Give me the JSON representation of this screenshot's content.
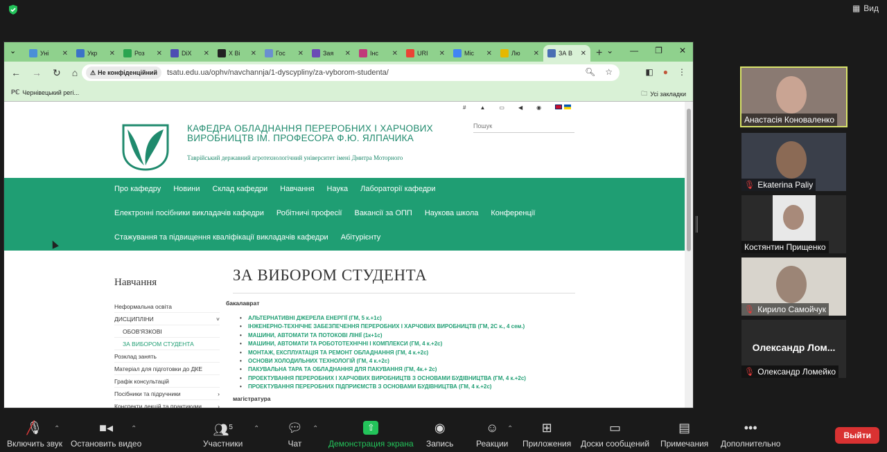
{
  "zoom": {
    "view_label": "Вид",
    "bottom": {
      "mute": "Включить звук",
      "video": "Остановить видео",
      "participants": "Участники",
      "participants_count": "5",
      "chat": "Чат",
      "share": "Демонстрация экрана",
      "record": "Запись",
      "reactions": "Реакции",
      "apps": "Приложения",
      "whiteboards": "Доски сообщений",
      "notes": "Примечания",
      "more": "Дополнительно",
      "leave": "Выйти"
    },
    "participants": [
      {
        "name": "Анастасія Коноваленко",
        "muted": false,
        "speaking": true
      },
      {
        "name": "Ekaterina Paliy",
        "muted": true
      },
      {
        "name": "Костянтин Прищенко",
        "muted": false
      },
      {
        "name": "Кирило Самойчук",
        "muted": true
      },
      {
        "name": "Олександр Ломейко",
        "display": "Олександр  Лом...",
        "muted": true
      }
    ]
  },
  "browser": {
    "tabs": [
      {
        "label": "Уні",
        "color": "#4a8fd8"
      },
      {
        "label": "Укр",
        "color": "#3b73c7"
      },
      {
        "label": "Роз",
        "color": "#2aa44f"
      },
      {
        "label": "DiX",
        "color": "#4d4db3"
      },
      {
        "label": "X Ві",
        "color": "#222222"
      },
      {
        "label": "Гос",
        "color": "#6a8fd0"
      },
      {
        "label": "Зая",
        "color": "#6b4bb5"
      },
      {
        "label": "Інс",
        "color": "#c03a7a"
      },
      {
        "label": "URI",
        "color": "#ea4335"
      },
      {
        "label": "Міс",
        "color": "#4285f4"
      },
      {
        "label": "Лю",
        "color": "#e6b800"
      },
      {
        "label": "ЗА В",
        "color": "#4a6fb3",
        "active": true
      }
    ],
    "insecure_label": "Не конфіденційний",
    "url": "tsatu.edu.ua/ophv/navchannja/1-dyscypliny/za-vyborom-studenta/",
    "bookmark": "Чернівецький регі...",
    "all_bookmarks": "Усі закладки"
  },
  "site": {
    "title": "КАФЕДРА ОБЛАДНАННЯ ПЕРЕРОБНИХ І ХАРЧОВИХ ВИРОБНИЦТВ ІМ. ПРОФЕСОРА Ф.Ю. ЯЛПАЧИКА",
    "subtitle": "Таврійський державний агротехнологічний університет імені Дмитра Моторного",
    "search_placeholder": "Пошук",
    "menu_row1": [
      "Про кафедру",
      "Новини",
      "Склад кафедри",
      "Навчання",
      "Наука",
      "Лабораторії кафедри"
    ],
    "menu_row2": [
      "Електронні посібники викладачів кафедри",
      "Робітничі професії",
      "Вакансії за ОПП",
      "Наукова школа",
      "Конференції"
    ],
    "menu_row3": [
      "Стажування та підвищення кваліфікації викладачів кафедри",
      "Абітурієнту"
    ],
    "sidebar_title": "Навчання",
    "sidebar": [
      {
        "label": "Неформальна освіта"
      },
      {
        "label": "ДИСЦИПЛІНИ",
        "chev": "˅"
      },
      {
        "label": "ОБОВ'ЯЗКОВІ",
        "sub": true
      },
      {
        "label": "ЗА ВИБОРОМ СТУДЕНТА",
        "sub": true,
        "active": true
      },
      {
        "label": "Розклад занять"
      },
      {
        "label": "Матеріал для підготовки до ДКЕ"
      },
      {
        "label": "Графік консультацій"
      },
      {
        "label": "Посібники та підручники",
        "chev": "›"
      },
      {
        "label": "Конспекти лекцій та практикуми",
        "chev": "›"
      }
    ],
    "page_title": "ЗА ВИБОРОМ СТУДЕНТА",
    "bachelor_label": "бакалаврат",
    "bachelor_list": [
      "АЛЬТЕРНАТИВНІ ДЖЕРЕЛА ЕНЕРГІЇ (ГМ, 5 к.+1с)",
      "ІНЖЕНЕРНО-ТЕХНІЧНЕ ЗАБЕЗПЕЧЕННЯ ПЕРЕРОБНИХ І ХАРЧОВИХ ВИРОБНИЦТВ (ГМ, 2С к., 4 сем.)",
      "МАШИНИ, АВТОМАТИ ТА ПОТОКОВІ ЛІНІЇ (1к+1с)",
      "МАШИНИ, АВТОМАТИ  ТА РОБОТОТЕХНІЧНІ І КОМПЛЕКСИ (ГМ, 4 к.+2с)",
      "МОНТАЖ, ЕКСПЛУАТАЦІЯ ТА РЕМОНТ ОБЛАДНАННЯ (ГМ, 4 к.+2с)",
      "ОСНОВИ ХОЛОДИЛЬНИХ ТЕХНОЛОГІЙ (ГМ, 4 к.+2с)",
      "ПАКУВАЛЬНА ТАРА ТА ОБЛАДНАННЯ ДЛЯ ПАКУВАННЯ (ГМ, 4к.+ 2с)",
      "ПРОЕКТУВАННЯ ПЕРЕРОБНИХ І ХАРЧОВИХ ВИРОБНИЦТВ З ОСНОВАМИ БУДІВНИЦТВА (ГМ, 4 к.+2с)",
      "ПРОЕКТУВАННЯ ПЕРЕРОБНИХ ПІДПРИЄМСТВ З ОСНОВАМИ БУДІВНИЦТВА (ГМ, 4 к.+2с)"
    ],
    "master_label": "магістратура"
  },
  "colors": {
    "brand": "#1f9e73",
    "chrome_tabs": "#8fd18d",
    "chrome_toolbar": "#d9f1d6",
    "share_green": "#23c35a",
    "leave_red": "#d93232",
    "speaking": "#d9e46a"
  }
}
